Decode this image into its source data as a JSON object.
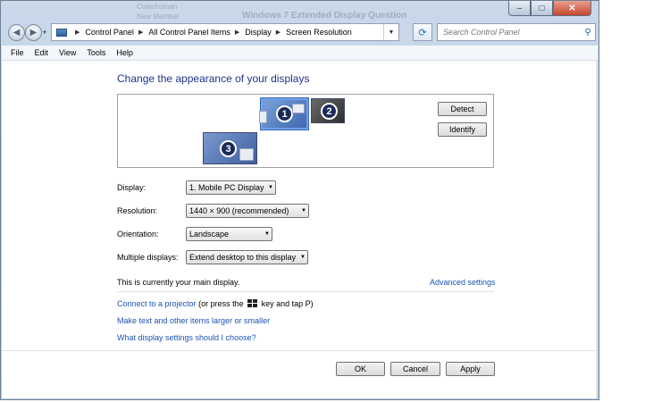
{
  "window": {
    "ghost_title": "Windows 7 Extended Display Question",
    "ghost_line1": "Cotechoman",
    "ghost_line2": "New Member"
  },
  "caption_buttons": {
    "minimize": "–",
    "maximize": "□",
    "close": "✕"
  },
  "nav": {
    "back_glyph": "◀",
    "forward_glyph": "▶",
    "breadcrumbs": [
      "Control Panel",
      "All Control Panel Items",
      "Display",
      "Screen Resolution"
    ],
    "search_placeholder": "Search Control Panel"
  },
  "menu": [
    "File",
    "Edit",
    "View",
    "Tools",
    "Help"
  ],
  "main": {
    "heading": "Change the appearance of your displays",
    "monitors": [
      "1",
      "2",
      "3"
    ],
    "detect_label": "Detect",
    "identify_label": "Identify",
    "fields": [
      {
        "label": "Display:",
        "value": "1. Mobile PC Display"
      },
      {
        "label": "Resolution:",
        "value": "1440 × 900 (recommended)"
      },
      {
        "label": "Orientation:",
        "value": "Landscape"
      },
      {
        "label": "Multiple displays:",
        "value": "Extend desktop to this display"
      }
    ],
    "main_display_note": "This is currently your main display.",
    "advanced_settings": "Advanced settings",
    "projector_link": "Connect to a projector",
    "projector_text_pre": "(or press the",
    "projector_text_post": "key and tap P)",
    "larger_link": "Make text and other items larger or smaller",
    "choose_link": "What display settings should I choose?"
  },
  "footer": {
    "ok": "OK",
    "cancel": "Cancel",
    "apply": "Apply"
  }
}
